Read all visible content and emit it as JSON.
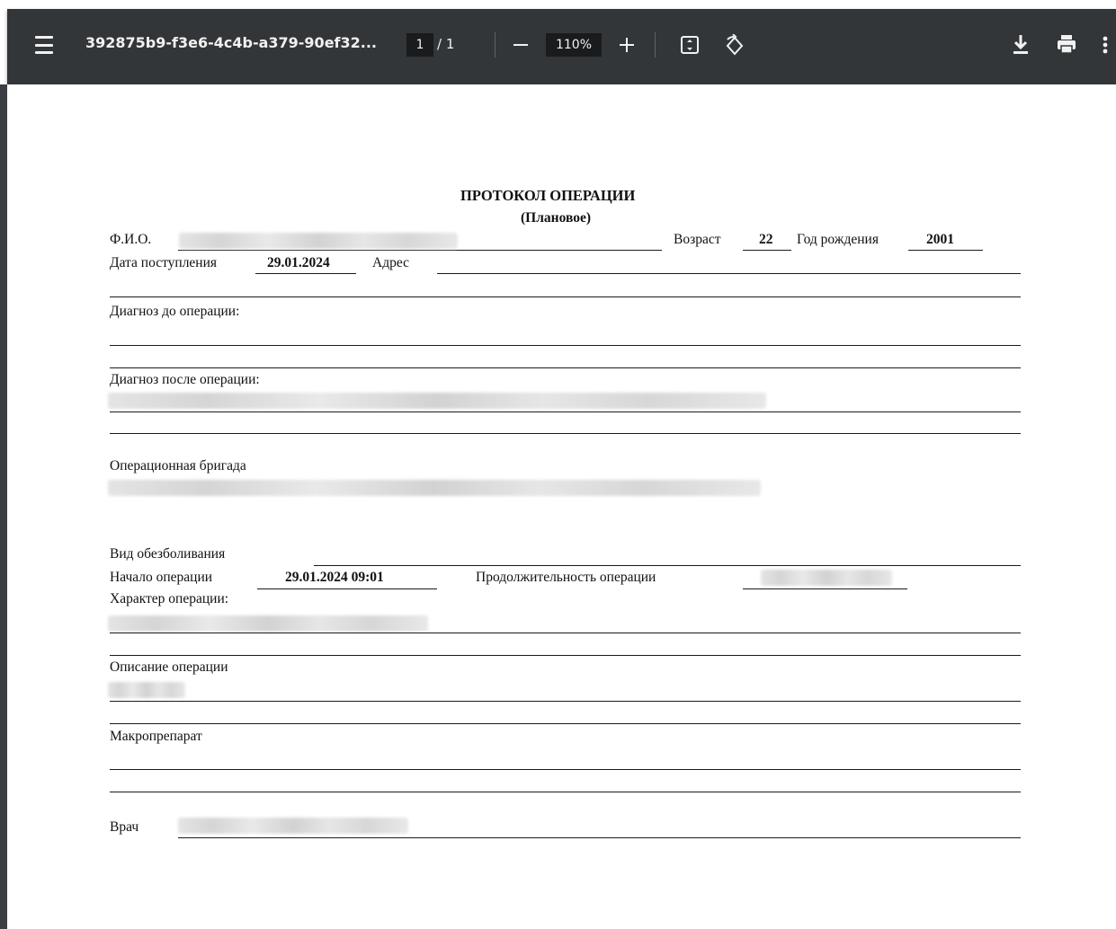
{
  "toolbar": {
    "title": "392875b9-f3e6-4c4b-a379-90ef32...",
    "page_current": "1",
    "page_total": "/  1",
    "zoom": "110%"
  },
  "icons": [
    "menu-icon",
    "zoom-out-icon",
    "zoom-in-icon",
    "fit-page-icon",
    "rotate-icon",
    "download-icon",
    "print-icon",
    "more-icon"
  ],
  "document": {
    "heading": "ПРОТОКОЛ ОПЕРАЦИИ",
    "subheading": "(Плановое)",
    "fio_label": "Ф.И.О.",
    "age_label": "Возраст",
    "age_value": "22",
    "birth_year_label": "Год рождения",
    "birth_year_value": "2001",
    "admission_label": "Дата поступления",
    "admission_value": "29.01.2024",
    "address_label": "Адрес",
    "diag_before_label": "Диагноз до операции:",
    "diag_after_label": "Диагноз после операции:",
    "team_label": "Операционная бригада",
    "anesthesia_label": "Вид обезболивания",
    "start_label": "Начало операции",
    "start_value": "29.01.2024 09:01",
    "duration_label": "Продолжительность операции",
    "character_label": "Характер операции:",
    "description_label": "Описание операции",
    "macro_label": "Макропрепарат",
    "doctor_label": "Врач"
  }
}
